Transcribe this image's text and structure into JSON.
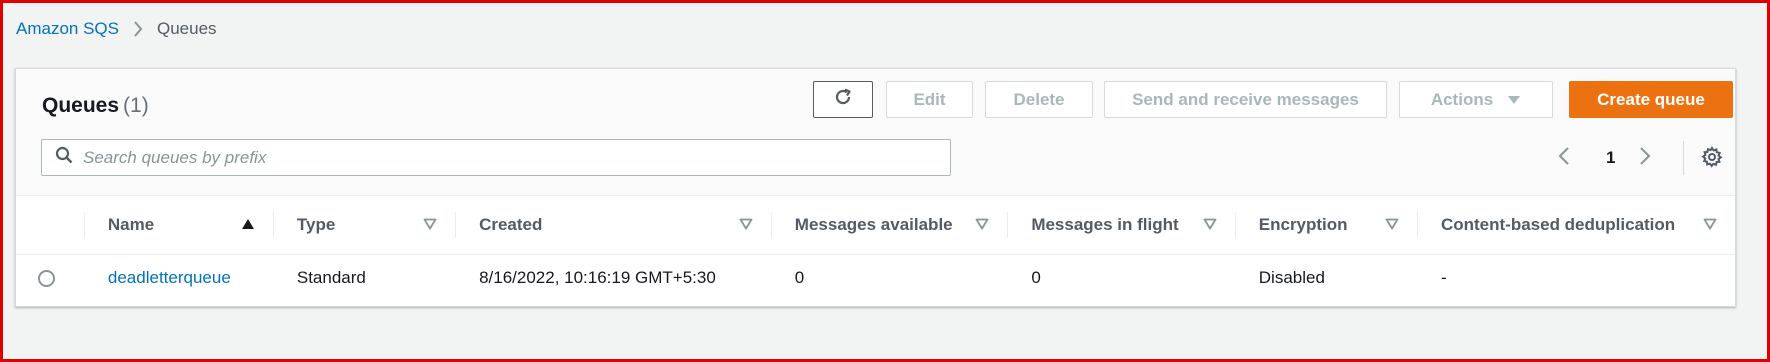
{
  "breadcrumb": {
    "parent": "Amazon SQS",
    "current": "Queues"
  },
  "header": {
    "title": "Queues",
    "count": "(1)"
  },
  "toolbar": {
    "refresh_icon": "refresh-icon",
    "edit_label": "Edit",
    "delete_label": "Delete",
    "send_label": "Send and receive messages",
    "actions_label": "Actions",
    "create_label": "Create queue"
  },
  "search": {
    "placeholder": "Search queues by prefix",
    "value": ""
  },
  "pagination": {
    "current_page": "1"
  },
  "table": {
    "columns": [
      {
        "label": "Name",
        "sort": "ascending"
      },
      {
        "label": "Type",
        "sort": "none"
      },
      {
        "label": "Created",
        "sort": "none"
      },
      {
        "label": "Messages available",
        "sort": "none"
      },
      {
        "label": "Messages in flight",
        "sort": "none"
      },
      {
        "label": "Encryption",
        "sort": "none"
      },
      {
        "label": "Content-based deduplication",
        "sort": "none"
      }
    ],
    "rows": [
      {
        "name": "deadletterqueue",
        "type": "Standard",
        "created": "8/16/2022, 10:16:19 GMT+5:30",
        "messages_available": "0",
        "messages_in_flight": "0",
        "encryption": "Disabled",
        "content_dedup": "-"
      }
    ]
  },
  "colors": {
    "link": "#0073bb",
    "primary_button": "#ec7211",
    "frame_border": "#e00000",
    "disabled_text": "#aab7b8"
  }
}
